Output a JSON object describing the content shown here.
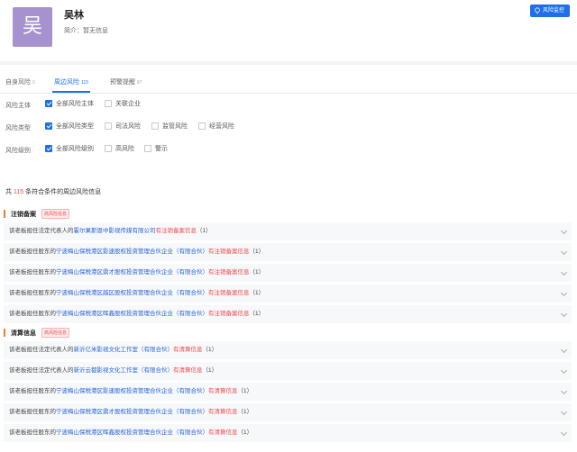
{
  "company": {
    "avatar_text": "吴",
    "name": "吴林",
    "intro": "简介：暂无信息"
  },
  "header": {
    "monitor_label": "风险监控"
  },
  "tabs": [
    {
      "label": "自身风险",
      "count": "0"
    },
    {
      "label": "周边风险",
      "count": "115"
    },
    {
      "label": "预警提醒",
      "count": "87"
    }
  ],
  "filters": {
    "subject": {
      "label": "风险主体",
      "options": [
        "全部风险主体",
        "关联企业"
      ]
    },
    "type": {
      "label": "风险类型",
      "options": [
        "全部风险类型",
        "司法风险",
        "监管风险",
        "经营风险"
      ]
    },
    "level": {
      "label": "风险级别",
      "options": [
        "全部风险级别",
        "高风险",
        "警示"
      ]
    }
  },
  "summary": {
    "prefix": "共",
    "count": "115",
    "suffix": "条符合条件的周边风险信息"
  },
  "sections": [
    {
      "title": "注销备案",
      "tag": "高风险信息",
      "rows": [
        {
          "prefix": "该老板担任法定代表人的",
          "entity": "霍尔果斯恩中影视传媒有限公司",
          "risk": "有注销备案信息",
          "count": "（1）"
        },
        {
          "prefix": "该老板担任股东的",
          "entity": "宁波梅山保税港区影速股权投资管理合伙企业（有限合伙）",
          "risk": "有注销备案信息",
          "count": "（1）"
        },
        {
          "prefix": "该老板担任股东的",
          "entity": "宁波梅山保税港区鼎才股权投资管理合伙企业（有限合伙）",
          "risk": "有注销备案信息",
          "count": "（1）"
        },
        {
          "prefix": "该老板担任股东的",
          "entity": "宁波梅山保税港区越区股权投资管理合伙企业（有限合伙）",
          "risk": "有注销备案信息",
          "count": "（1）"
        },
        {
          "prefix": "该老板担任股东的",
          "entity": "宁波梅山保税港区晖鑫股权投资管理合伙企业（有限合伙）",
          "risk": "有注销备案信息",
          "count": "（1）"
        }
      ]
    },
    {
      "title": "清算信息",
      "tag": "高风险信息",
      "rows": [
        {
          "prefix": "该老板担任法定代表人的",
          "entity": "新沂亿米影视文化工作室（有限合伙）",
          "risk": "有清算信息",
          "count": "（1）"
        },
        {
          "prefix": "该老板担任法定代表人的",
          "entity": "新沂云都影视文化工作室（有限合伙）",
          "risk": "有清算信息",
          "count": "（1）"
        },
        {
          "prefix": "该老板担任股东的",
          "entity": "宁波梅山保税港区影速股权投资管理合伙企业（有限合伙）",
          "risk": "有清算信息",
          "count": "（1）"
        },
        {
          "prefix": "该老板担任股东的",
          "entity": "宁波梅山保税港区鼎才股权投资管理合伙企业（有限合伙）",
          "risk": "有清算信息",
          "count": "（1）"
        },
        {
          "prefix": "该老板担任股东的",
          "entity": "宁波梅山保税港区晖鑫股权投资管理合伙企业（有限合伙）",
          "risk": "有清算信息",
          "count": "（1）"
        }
      ]
    }
  ]
}
